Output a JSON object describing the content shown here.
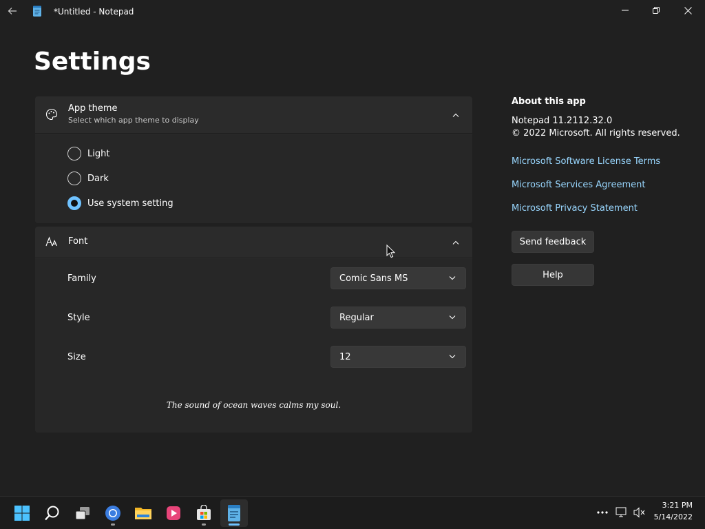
{
  "window": {
    "title": "*Untitled - Notepad"
  },
  "page": {
    "title": "Settings"
  },
  "app_theme": {
    "title": "App theme",
    "subtitle": "Select which app theme to display",
    "options": [
      {
        "label": "Light",
        "selected": false
      },
      {
        "label": "Dark",
        "selected": false
      },
      {
        "label": "Use system setting",
        "selected": true
      }
    ]
  },
  "font": {
    "title": "Font",
    "family_label": "Family",
    "family_value": "Comic Sans MS",
    "style_label": "Style",
    "style_value": "Regular",
    "size_label": "Size",
    "size_value": "12",
    "preview": "The sound of ocean waves calms my soul."
  },
  "about": {
    "title": "About this app",
    "version": "Notepad 11.2112.32.0",
    "copyright": "© 2022 Microsoft. All rights reserved.",
    "links": [
      "Microsoft Software License Terms",
      "Microsoft Services Agreement",
      "Microsoft Privacy Statement"
    ],
    "feedback_button": "Send feedback",
    "help_button": "Help"
  },
  "taskbar": {
    "time": "3:21 PM",
    "date": "5/14/2022",
    "apps": [
      "start-icon",
      "search-icon",
      "task-view-icon",
      "chrome-icon",
      "file-explorer-icon",
      "media-player-icon",
      "store-icon",
      "notepad-icon"
    ]
  },
  "colors": {
    "accent": "#6fc2ff",
    "link": "#99d7ff",
    "background": "#202020",
    "card": "#2b2b2b"
  }
}
